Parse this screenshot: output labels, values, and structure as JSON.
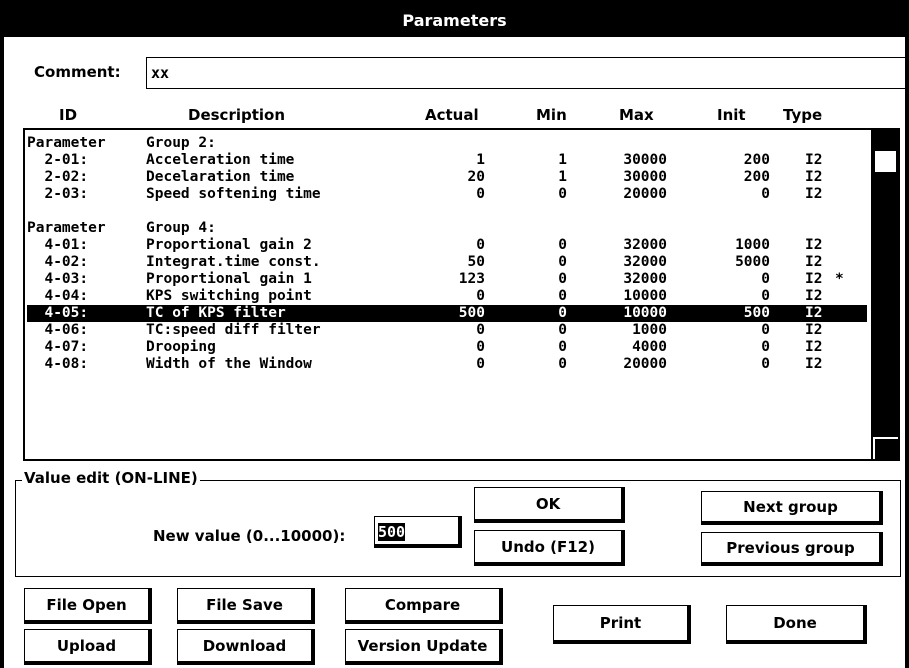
{
  "window": {
    "title": "Parameters"
  },
  "comment": {
    "label": "Comment:",
    "value": "xx"
  },
  "columns": [
    "ID",
    "Description",
    "Actual",
    "Min",
    "Max",
    "Init",
    "Type"
  ],
  "rows": [
    {
      "id": "Parameter",
      "desc": "Group 2:",
      "actual": "",
      "min": "",
      "max": "",
      "init": "",
      "type": "",
      "mark": ""
    },
    {
      "id": "  2-01:",
      "desc": "Acceleration time",
      "actual": "1",
      "min": "1",
      "max": "30000",
      "init": "200",
      "type": "I2",
      "mark": ""
    },
    {
      "id": "  2-02:",
      "desc": "Decelaration time",
      "actual": "20",
      "min": "1",
      "max": "30000",
      "init": "200",
      "type": "I2",
      "mark": ""
    },
    {
      "id": "  2-03:",
      "desc": "Speed softening time",
      "actual": "0",
      "min": "0",
      "max": "20000",
      "init": "0",
      "type": "I2",
      "mark": ""
    },
    {
      "id": "",
      "desc": "",
      "actual": "",
      "min": "",
      "max": "",
      "init": "",
      "type": "",
      "mark": ""
    },
    {
      "id": "Parameter",
      "desc": "Group 4:",
      "actual": "",
      "min": "",
      "max": "",
      "init": "",
      "type": "",
      "mark": ""
    },
    {
      "id": "  4-01:",
      "desc": "Proportional gain 2",
      "actual": "0",
      "min": "0",
      "max": "32000",
      "init": "1000",
      "type": "I2",
      "mark": ""
    },
    {
      "id": "  4-02:",
      "desc": "Integrat.time const.",
      "actual": "50",
      "min": "0",
      "max": "32000",
      "init": "5000",
      "type": "I2",
      "mark": ""
    },
    {
      "id": "  4-03:",
      "desc": "Proportional gain 1",
      "actual": "123",
      "min": "0",
      "max": "32000",
      "init": "0",
      "type": "I2",
      "mark": "*"
    },
    {
      "id": "  4-04:",
      "desc": "KPS switching point",
      "actual": "0",
      "min": "0",
      "max": "10000",
      "init": "0",
      "type": "I2",
      "mark": ""
    },
    {
      "id": "  4-05:",
      "desc": "TC of KPS filter",
      "actual": "500",
      "min": "0",
      "max": "10000",
      "init": "500",
      "type": "I2",
      "mark": ""
    },
    {
      "id": "  4-06:",
      "desc": "TC:speed diff filter",
      "actual": "0",
      "min": "0",
      "max": "1000",
      "init": "0",
      "type": "I2",
      "mark": ""
    },
    {
      "id": "  4-07:",
      "desc": "Drooping",
      "actual": "0",
      "min": "0",
      "max": "4000",
      "init": "0",
      "type": "I2",
      "mark": ""
    },
    {
      "id": "  4-08:",
      "desc": "Width of the Window",
      "actual": "0",
      "min": "0",
      "max": "20000",
      "init": "0",
      "type": "I2",
      "mark": ""
    }
  ],
  "selected_index": 10,
  "value_edit": {
    "legend": "Value edit (ON-LINE)",
    "new_value_label": "New value (0...10000):",
    "new_value": "500"
  },
  "buttons": {
    "ok": "OK",
    "undo": "Undo (F12)",
    "next_group": "Next group",
    "previous_group": "Previous group",
    "file_open": "File Open",
    "file_save": "File Save",
    "compare": "Compare",
    "upload": "Upload",
    "download": "Download",
    "version_update": "Version Update",
    "print": "Print",
    "done": "Done"
  }
}
